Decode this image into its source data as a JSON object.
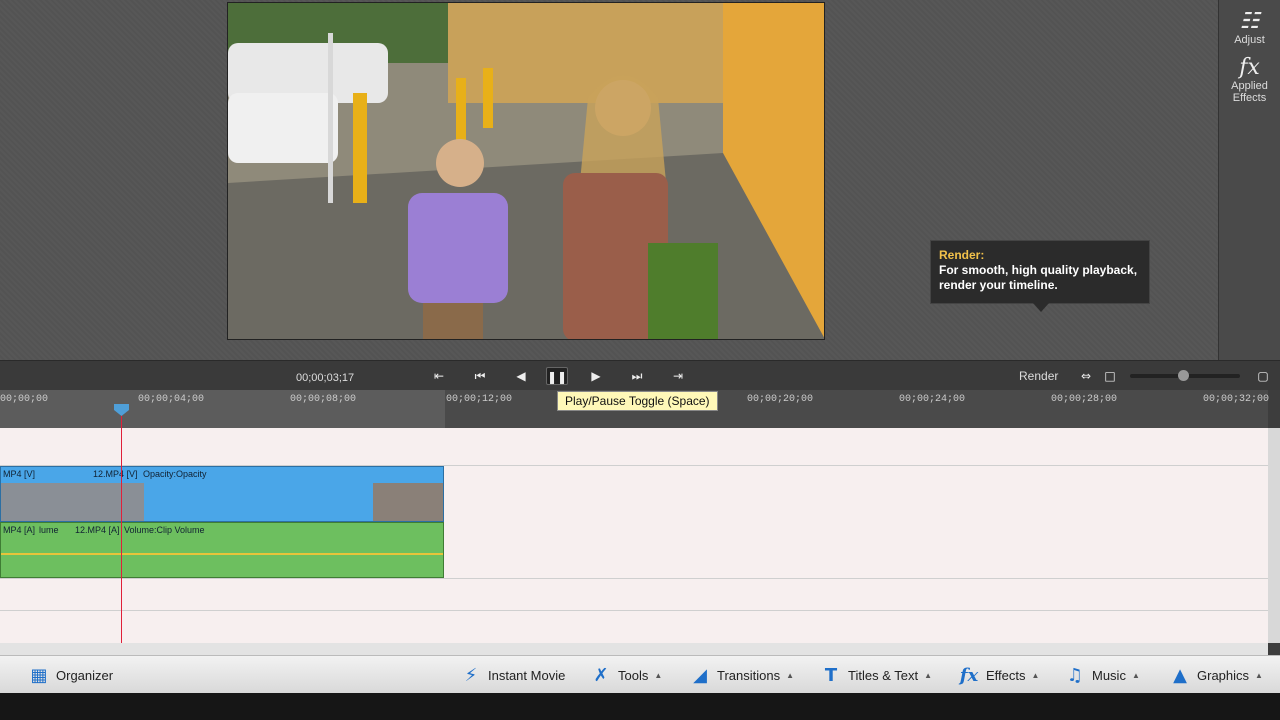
{
  "right_panel": {
    "adjust_label": "Adjust",
    "applied_effects_label": "Applied Effects"
  },
  "render_tip": {
    "title": "Render:",
    "body": "For smooth, high quality playback, render your timeline."
  },
  "transport": {
    "timecode": "00;00;03;17",
    "render_label": "Render"
  },
  "play_tooltip": "Play/Pause Toggle (Space)",
  "ruler": {
    "labels": [
      "00;00;00",
      "00;00;04;00",
      "00;00;08;00",
      "00;00;12;00",
      "00;00;20;00",
      "00;00;24;00",
      "00;00;28;00",
      "00;00;32;00"
    ]
  },
  "clips": {
    "video_left": "MP4 [V]",
    "video_main": "12.MP4 [V]",
    "video_prop": "Opacity:Opacity",
    "audio_left": "MP4 [A]",
    "audio_left_prop": "lume",
    "audio_main": "12.MP4 [A]",
    "audio_prop": "Volume:Clip Volume"
  },
  "bottombar": {
    "organizer": "Organizer",
    "instant_movie": "Instant Movie",
    "tools": "Tools",
    "transitions": "Transitions",
    "titles_text": "Titles & Text",
    "effects": "Effects",
    "music": "Music",
    "graphics": "Graphics"
  },
  "colors": {
    "accent": "#1f6fc9",
    "playhead": "#e0203a",
    "video_clip": "#4aa6e8",
    "audio_clip": "#6dbf5f",
    "tooltip_title": "#f3c24a"
  }
}
